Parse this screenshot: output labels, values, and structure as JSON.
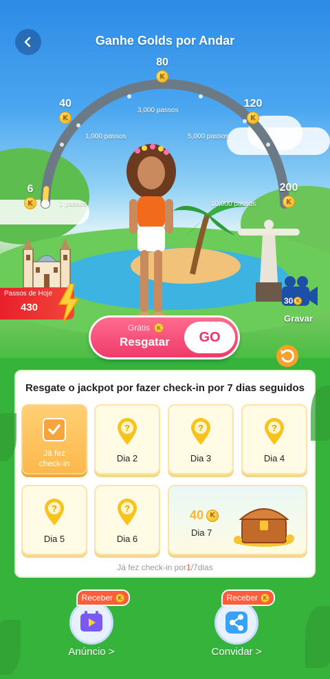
{
  "header": {
    "title": "Ganhe Golds por Andar"
  },
  "gauge": {
    "milestones": [
      {
        "coins": "6",
        "coin_icon": "K"
      },
      {
        "coins": "40",
        "coin_icon": "K"
      },
      {
        "coins": "80",
        "coin_icon": "K"
      },
      {
        "coins": "120",
        "coin_icon": "K"
      },
      {
        "coins": "200",
        "coin_icon": "K"
      }
    ],
    "step_labels": [
      "1 passos",
      "1,000 passos",
      "3,000 passos",
      "5,000 passos",
      "10,000 passos"
    ],
    "progress_fraction": 0.04,
    "colors": {
      "track": "#6c7a86",
      "fill": "#ffd64b"
    }
  },
  "today_steps": {
    "label": "Passos de Hoje",
    "value": "430"
  },
  "record": {
    "count": "30",
    "coin_icon": "K",
    "label": "Gravar"
  },
  "claim": {
    "free_label": "Grátis",
    "coin_icon": "K",
    "claim_label": "Resgatar",
    "go_label": "GO"
  },
  "checkin": {
    "title": "Resgate o jackpot por fazer check-in por 7 dias seguidos",
    "days": [
      {
        "label": "Já fez check-in",
        "done": true
      },
      {
        "label": "Dia 2",
        "done": false
      },
      {
        "label": "Dia 3",
        "done": false
      },
      {
        "label": "Dia 4",
        "done": false
      },
      {
        "label": "Dia 5",
        "done": false
      },
      {
        "label": "Dia 6",
        "done": false
      },
      {
        "label": "Dia 7",
        "reward": "40",
        "coin_icon": "K",
        "done": false
      }
    ],
    "progress": {
      "prefix": "Já fez check-in por",
      "current": "1",
      "suffix": "/7dias"
    }
  },
  "actions": [
    {
      "label": "Anúncio >",
      "badge": "Receber",
      "coin_icon": "K"
    },
    {
      "label": "Convidar >",
      "badge": "Receber",
      "coin_icon": "K"
    }
  ]
}
